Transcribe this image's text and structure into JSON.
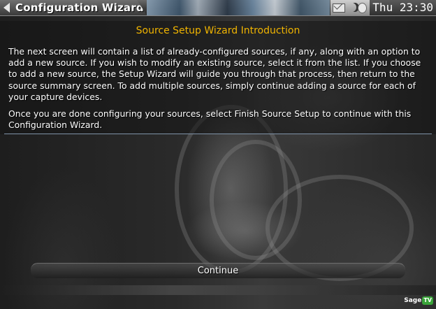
{
  "window": {
    "title": "Configuration Wizard",
    "clock": "Thu 23:30"
  },
  "status_icons": [
    "mail-icon",
    "moon-icon",
    "moon-icon"
  ],
  "main": {
    "heading": "Source Setup Wizard Introduction",
    "paragraphs": [
      "The next screen will contain a list of already-configured sources, if any, along with an option to add a new source. If you wish to modify an existing source, select it from the list. If you choose to add a new source, the Setup Wizard will guide you through that process, then return to the source summary screen. To add multiple sources, simply continue adding a source for each of your capture devices.",
      "Once you are done configuring your sources, select Finish Source Setup to continue with this Configuration Wizard."
    ]
  },
  "footer": {
    "continue_label": "Continue"
  },
  "logo": {
    "text": "Sage",
    "badge": "TV"
  },
  "colors": {
    "heading": "#f0b400",
    "text": "#ffffff",
    "divider": "#7f93a8"
  }
}
